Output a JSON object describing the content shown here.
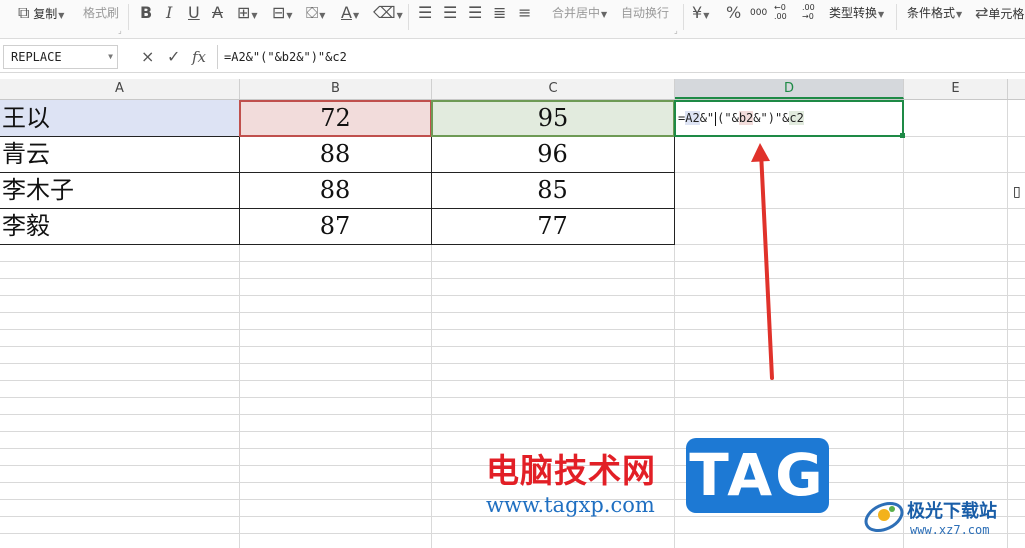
{
  "toolbar": {
    "copy": "复制",
    "format_painter": "格式刷",
    "merge_center": "合并居中",
    "wrap_text": "自动换行",
    "currency": "¥",
    "percent": "%",
    "thousands": "000",
    "inc_decimal": "←0 .00",
    "dec_decimal": ".00 →0",
    "type_convert": "类型转换",
    "cond_format": "条件格式",
    "cell_style": "单元格"
  },
  "formula_bar": {
    "name_box": "REPLACE",
    "cancel": "×",
    "confirm": "✓",
    "fx": "fx",
    "formula": "=A2&\"(\"&b2&\")\"&c2"
  },
  "columns": [
    "A",
    "B",
    "C",
    "D",
    "E"
  ],
  "rows": [
    {
      "name": "王以",
      "b": "72",
      "c": "95"
    },
    {
      "name": "青云",
      "b": "88",
      "c": "96"
    },
    {
      "name": "李木子",
      "b": "88",
      "c": "85"
    },
    {
      "name": "李毅",
      "b": "87",
      "c": "77"
    }
  ],
  "edit_cell": {
    "t1": "=",
    "ref_a": "A2",
    "t2": "&\"",
    "t3": "(\"&",
    "ref_b": "b2",
    "t4": "&\")\"&",
    "ref_c": "c2"
  },
  "watermark": {
    "title": "电脑技术网",
    "url": "www.tagxp.com",
    "badge": "TAG",
    "site_name": "极光下载站",
    "site_url": "www.xz7.com"
  },
  "colors": {
    "active_green": "#1e8a46",
    "ref_blue": "#dde3f4",
    "ref_red": "#f2dcdb",
    "ref_green": "#e2ebde",
    "arrow_red": "#e0322b"
  }
}
